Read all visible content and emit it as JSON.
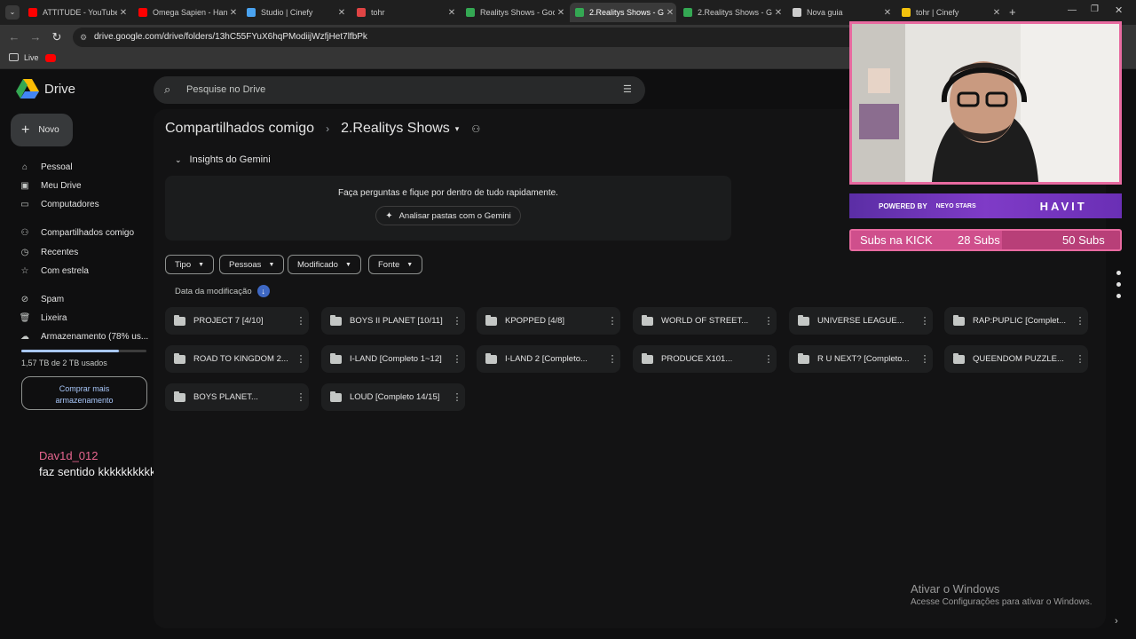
{
  "browser": {
    "tabs": [
      {
        "title": "ATTITUDE - YouTube",
        "favicon": "youtube-icon",
        "color": "#ff0000"
      },
      {
        "title": "Omega Sapien - Han",
        "favicon": "youtube-icon",
        "color": "#ff0000"
      },
      {
        "title": "Studio | Cinefy",
        "favicon": "cinefy-icon",
        "color": "#4aa3f0"
      },
      {
        "title": "tohr",
        "favicon": "app-icon",
        "color": "#e04444"
      },
      {
        "title": "Realitys Shows - Goo",
        "favicon": "drive-icon",
        "color": "#34a853"
      },
      {
        "title": "2.Realitys Shows - Go",
        "favicon": "drive-icon",
        "color": "#34a853"
      },
      {
        "title": "2.Realitys Shows - Go",
        "favicon": "drive-icon",
        "color": "#34a853"
      },
      {
        "title": "Nova guia",
        "favicon": "globe-icon",
        "color": "#cccccc"
      },
      {
        "title": "tohr | Cinefy",
        "favicon": "cinefy-icon",
        "color": "#f4c20d"
      }
    ],
    "active_tab": 5,
    "url": "drive.google.com/drive/folders/13hC55FYuX6hqPModiijWzfjHet7lfbPk",
    "bookmark_label": "Live"
  },
  "drive": {
    "app_name": "Drive",
    "search_placeholder": "Pesquise no Drive",
    "new_label": "Novo",
    "nav": [
      {
        "label": "Pessoal",
        "icon": "home-icon"
      },
      {
        "label": "Meu Drive",
        "icon": "drive-icon"
      },
      {
        "label": "Computadores",
        "icon": "computer-icon"
      },
      {
        "label": "Compartilhados comigo",
        "icon": "people-icon"
      },
      {
        "label": "Recentes",
        "icon": "clock-icon"
      },
      {
        "label": "Com estrela",
        "icon": "star-icon"
      },
      {
        "label": "Spam",
        "icon": "spam-icon"
      },
      {
        "label": "Lixeira",
        "icon": "trash-icon"
      },
      {
        "label": "Armazenamento (78% us...",
        "icon": "cloud-icon"
      }
    ],
    "storage_used_fraction": 0.78,
    "storage_text": "1,57 TB de 2 TB usados",
    "buy_storage_line1": "Comprar mais",
    "buy_storage_line2": "armazenamento",
    "breadcrumb": {
      "parent": "Compartilhados comigo",
      "current": "2.Realitys Shows"
    },
    "gemini": {
      "header": "Insights do Gemini",
      "prompt": "Faça perguntas e fique por dentro de tudo rapidamente.",
      "button": "Analisar pastas com o Gemini"
    },
    "filters": [
      "Tipo",
      "Pessoas",
      "Modificado",
      "Fonte"
    ],
    "sort_label": "Data da modificação",
    "folders": [
      "PROJECT 7 [4/10]",
      "BOYS II PLANET [10/11]",
      "KPOPPED [4/8]",
      "WORLD OF STREET...",
      "UNIVERSE LEAGUE...",
      "RAP:PUPLIC [Complet...",
      "ROAD TO KINGDOM 2...",
      "I-LAND [Completo 1~12]",
      "I-LAND 2 [Completo...",
      "PRODUCE X101...",
      "R U NEXT? [Completo...",
      "QUEENDOM PUZZLE...",
      "BOYS PLANET...",
      "LOUD [Completo 14/15]"
    ]
  },
  "chat": {
    "user": "Dav1d_012",
    "message": "faz sentido kkkkkkkkkk"
  },
  "overlay": {
    "sponsor_left": "POWERED BY",
    "sponsor_mid": "NEYO STARS",
    "sponsor_right": "HAVIT",
    "subs_label": "Subs na KICK",
    "subs_current": "28 Subs",
    "subs_goal": "50 Subs",
    "subs_progress": 0.56
  },
  "windows_watermark": {
    "line1": "Ativar o Windows",
    "line2": "Acesse Configurações para ativar o Windows."
  }
}
